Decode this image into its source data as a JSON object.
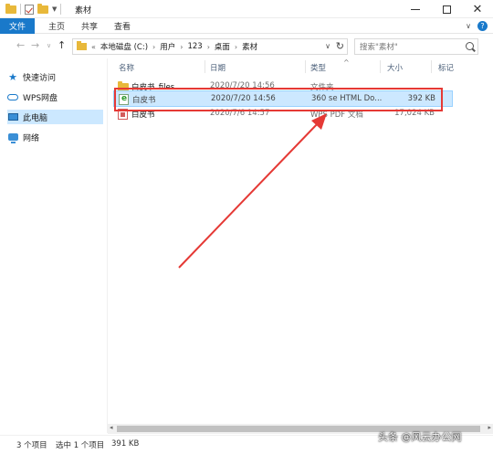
{
  "window": {
    "title": "素材"
  },
  "window_controls": {
    "minimize": "",
    "maximize": "",
    "close": "✕"
  },
  "ribbon": {
    "tabs": [
      {
        "label": "文件"
      },
      {
        "label": "主页"
      },
      {
        "label": "共享"
      },
      {
        "label": "查看"
      }
    ],
    "help": "?"
  },
  "address": {
    "crumbs": [
      "本地磁盘 (C:)",
      "用户",
      "123",
      "桌面",
      "素材"
    ],
    "overflow": "«",
    "search_placeholder": "搜索\"素材\""
  },
  "nav": {
    "items": [
      {
        "label": "快速访问",
        "icon": "star-icon"
      },
      {
        "label": "WPS网盘",
        "icon": "cloud-icon"
      },
      {
        "label": "此电脑",
        "icon": "computer-icon"
      },
      {
        "label": "网络",
        "icon": "network-icon"
      }
    ]
  },
  "columns": {
    "name": "名称",
    "date": "日期",
    "type": "类型",
    "size": "大小",
    "tags": "标记"
  },
  "files": [
    {
      "name": "白皮书_files",
      "date": "2020/7/20 14:56",
      "type": "文件夹",
      "size": "",
      "icon": "folder-icon"
    },
    {
      "name": "白皮书",
      "date": "2020/7/20 14:56",
      "type": "360 se HTML Do...",
      "size": "392 KB",
      "icon": "html-file-icon"
    },
    {
      "name": "白皮书",
      "date": "2020/7/6 14:57",
      "type": "WPS PDF 文档",
      "size": "17,024 KB",
      "icon": "pdf-file-icon"
    }
  ],
  "status": {
    "item_count": "3 个项目",
    "selection": "选中 1 个项目",
    "selected_size": "391 KB"
  },
  "watermark": "头条 @风云办公网",
  "colors": {
    "accent": "#1979ca",
    "selection": "#cce8ff",
    "annotation": "#e53935"
  }
}
